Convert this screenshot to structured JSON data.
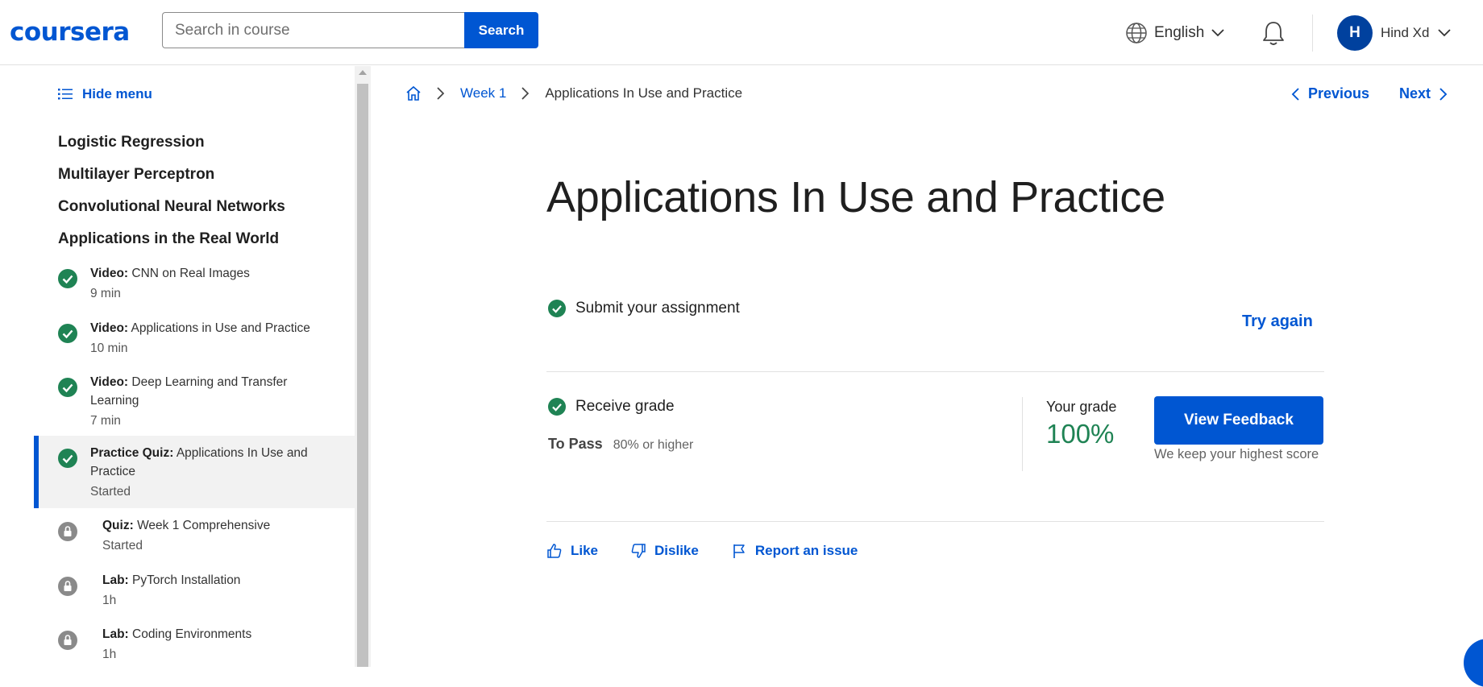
{
  "header": {
    "logo": "coursera",
    "search_placeholder": "Search in course",
    "search_button": "Search",
    "language": "English",
    "user_initial": "H",
    "user_name": "Hind Xd"
  },
  "sidebar": {
    "hide_menu": "Hide menu",
    "modules": [
      "Logistic Regression",
      "Multilayer Perceptron",
      "Convolutional Neural Networks",
      "Applications in the Real World"
    ],
    "items": [
      {
        "type": "Video:",
        "title": "CNN on Real Images",
        "meta": "9 min",
        "status": "completed"
      },
      {
        "type": "Video:",
        "title": "Applications in Use and Practice",
        "meta": "10 min",
        "status": "completed"
      },
      {
        "type": "Video:",
        "title": "Deep Learning and Transfer Learning",
        "meta": "7 min",
        "status": "completed"
      },
      {
        "type": "Practice Quiz:",
        "title": "Applications In Use and Practice",
        "meta": "Started",
        "status": "completed",
        "active": true
      },
      {
        "type": "Quiz:",
        "title": "Week 1 Comprehensive",
        "meta": "Started",
        "status": "locked"
      },
      {
        "type": "Lab:",
        "title": "PyTorch Installation",
        "meta": "1h",
        "status": "locked"
      },
      {
        "type": "Lab:",
        "title": "Coding Environments",
        "meta": "1h",
        "status": "locked"
      }
    ]
  },
  "breadcrumb": {
    "week": "Week 1",
    "current": "Applications In Use and Practice"
  },
  "nav": {
    "previous": "Previous",
    "next": "Next"
  },
  "main": {
    "title": "Applications In Use and Practice",
    "submit_label": "Submit your assignment",
    "try_again": "Try again",
    "receive_label": "Receive grade",
    "to_pass_label": "To Pass",
    "to_pass_value": "80% or higher",
    "your_grade_label": "Your grade",
    "grade_value": "100%",
    "view_feedback": "View Feedback",
    "keep_score": "We keep your highest score"
  },
  "actions": {
    "like": "Like",
    "dislike": "Dislike",
    "report": "Report an issue"
  },
  "colors": {
    "brand": "#0056d2",
    "success": "#1f8354",
    "locked": "#8a8a8a"
  }
}
